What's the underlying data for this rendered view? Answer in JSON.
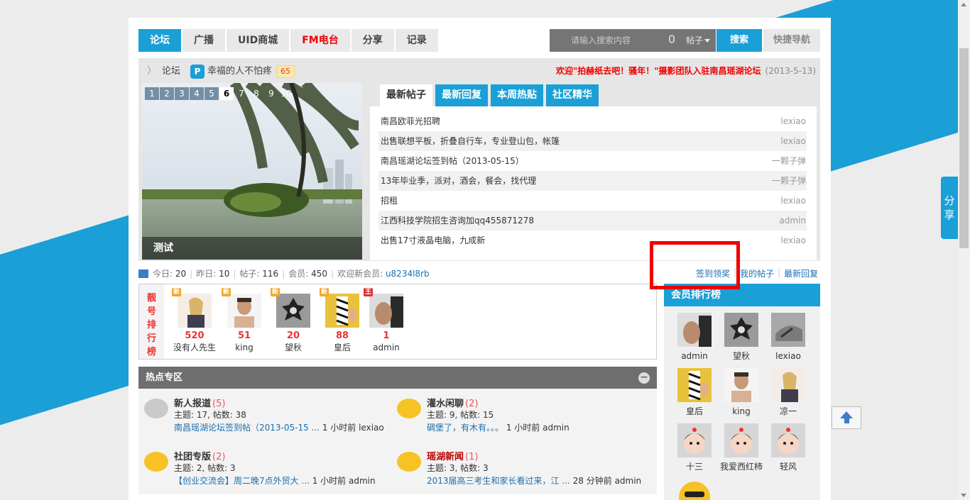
{
  "nav": {
    "tabs": [
      {
        "label": "论坛",
        "active": true
      },
      {
        "label": "广播"
      },
      {
        "label": "UID商城"
      },
      {
        "label": "FM电台",
        "red": true
      },
      {
        "label": "分享"
      },
      {
        "label": "记录"
      }
    ],
    "search_placeholder": "请输入搜索内容",
    "search_type": "帖子",
    "search_button": "搜索",
    "quick_nav": "快捷导航"
  },
  "breadcrumb": {
    "home": "论坛",
    "user": "幸福的人不怕疼",
    "level": "65"
  },
  "announcement": {
    "text": "欢迎\"拍赫纸去吧！骚年！\"摄影团队入驻南昌瑶湖论坛",
    "date": "(2013-5-13)"
  },
  "slideshow": {
    "numbers": [
      "1",
      "2",
      "3",
      "4",
      "5",
      "6",
      "7",
      "8",
      "9",
      "10"
    ],
    "active": "6",
    "caption": "测试"
  },
  "post_tabs": [
    "最新帖子",
    "最新回复",
    "本周热贴",
    "社区精华"
  ],
  "posts": [
    {
      "title": "南昌欧菲光招聘",
      "author": "lexiao"
    },
    {
      "title": "出售联想平板，折叠自行车，专业登山包，帐篷",
      "author": "lexiao"
    },
    {
      "title": "南昌瑶湖论坛签到帖（2013-05-15）",
      "author": "一颗子弹"
    },
    {
      "title": "13年毕业季，派对，酒会，餐会，找代理",
      "author": "一颗子弹"
    },
    {
      "title": "招租",
      "author": "lexiao"
    },
    {
      "title": "江西科技学院招生咨询加qq455871278",
      "author": "admin"
    },
    {
      "title": "出售17寸液晶电脑，九成新",
      "author": "lexiao"
    }
  ],
  "stats": {
    "today_label": "今日:",
    "today": "20",
    "yesterday_label": "昨日:",
    "yesterday": "10",
    "posts_label": "帖子:",
    "posts": "116",
    "members_label": "会员:",
    "members": "450",
    "welcome_label": "欢迎新会员:",
    "newest_member": "u8234l8rb"
  },
  "quick_links": [
    "签到领奖",
    "我的帖子",
    "最新回复"
  ],
  "rich_list": {
    "title": "靓号排行榜",
    "users": [
      {
        "value": "520",
        "name": "没有人先生",
        "badge": "新"
      },
      {
        "value": "51",
        "name": "king",
        "badge": "新"
      },
      {
        "value": "20",
        "name": "望秋",
        "badge": "新"
      },
      {
        "value": "88",
        "name": "皇后",
        "badge": "新"
      },
      {
        "value": "1",
        "name": "admin",
        "badge": "王"
      }
    ]
  },
  "hot": {
    "title": "热点专区",
    "forums": [
      {
        "name": "新人报道",
        "count": "(5)",
        "stats": "主题: 17, 帖数: 38",
        "last_post": "南昌瑶湖论坛签到帖（2013-05-15 ...",
        "time": "1 小时前",
        "author": "lexiao",
        "icon": "gray"
      },
      {
        "name": "灌水闲聊",
        "count": "(2)",
        "stats": "主题: 9, 帖数: 15",
        "last_post": "碉堡了，有木有。。。",
        "time": "1 小时前",
        "author": "admin",
        "icon": "yellow"
      },
      {
        "name": "社团专版",
        "count": "(2)",
        "stats": "主题: 2, 帖数: 3",
        "last_post": "【创业交流会】周二晚7点外贸大 ...",
        "time": "1 小时前",
        "author": "admin",
        "icon": "yellow"
      },
      {
        "name": "瑶湖新闻",
        "count": "(1)",
        "stats": "主题: 3, 帖数: 3",
        "last_post": "2013届高三考生和家长看过来，江 ...",
        "time": "28 分钟前",
        "author": "admin",
        "icon": "yellow",
        "red": true
      }
    ]
  },
  "member_rank": {
    "title": "会员排行榜",
    "members": [
      "admin",
      "望秋",
      "lexiao",
      "皇后",
      "king",
      "凉一",
      "十三",
      "我爱西红柿",
      "轻风"
    ]
  },
  "side_share": "分享",
  "colors": {
    "accent": "#1a9fd6",
    "red": "#e00000",
    "hot_head": "#6e6e6e"
  }
}
